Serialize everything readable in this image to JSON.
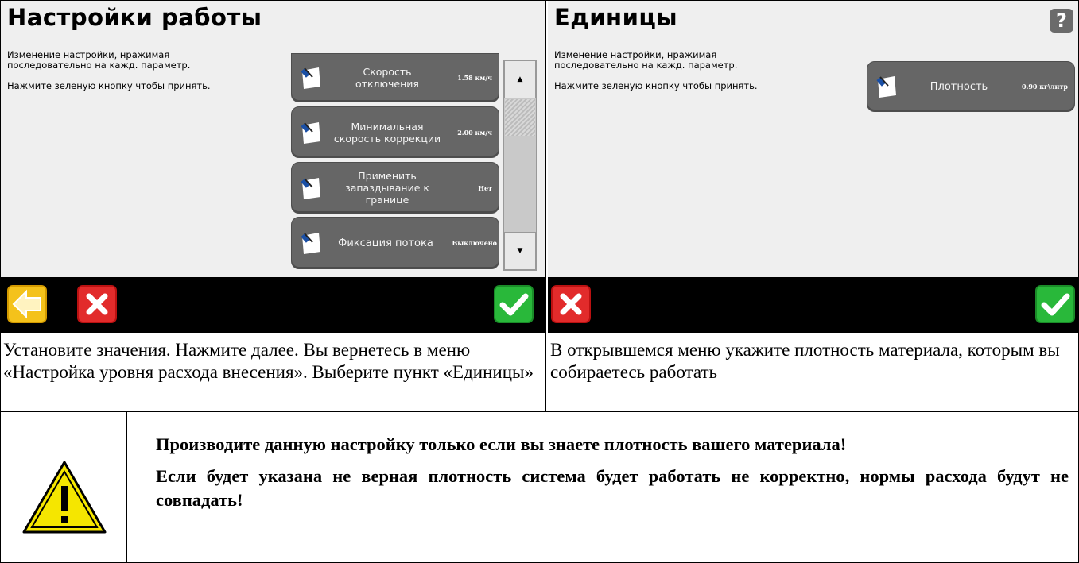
{
  "left_screen": {
    "title": "Настройки работы",
    "instructions": [
      "Изменение настройки, нражимая последовательно на кажд. параметр.",
      "Нажмите зеленую кнопку чтобы принять."
    ],
    "items": [
      {
        "label": "Скорость отключения",
        "value": "1.58 км/ч"
      },
      {
        "label": "Минимальная скорость коррекции",
        "value": "2.00 км/ч"
      },
      {
        "label": "Применить запаздывание к границе",
        "value": "Нет"
      },
      {
        "label": "Фиксация потока",
        "value": "Выключено"
      }
    ],
    "scroll": {
      "up": "▲",
      "down": "▼"
    }
  },
  "right_screen": {
    "title": "Единицы",
    "help_label": "?",
    "instructions": [
      "Изменение настройки, нражимая последовательно на кажд. параметр.",
      "Нажмите зеленую кнопку чтобы принять."
    ],
    "items": [
      {
        "label": "Плотность",
        "value": "0.90 кг\\литр"
      }
    ]
  },
  "captions": {
    "left": "Установите значения. Нажмите далее. Вы вернетесь в меню «Настройка уровня расхода внесения». Выберите пункт «Единицы»",
    "right": "В открывшемся меню укажите плотность материала, которым вы собираетесь работать"
  },
  "warning": {
    "line1": "Производите данную настройку только если вы знаете плотность вашего материала!",
    "line2": "Если будет указана не верная плотность система будет работать не корректно, нормы расхода будут не совпадать!"
  },
  "colors": {
    "back": "#f4c21b",
    "cancel": "#e22b2b",
    "accept": "#29b83a",
    "button_bg": "#666666",
    "screen_bg": "#efefef"
  }
}
